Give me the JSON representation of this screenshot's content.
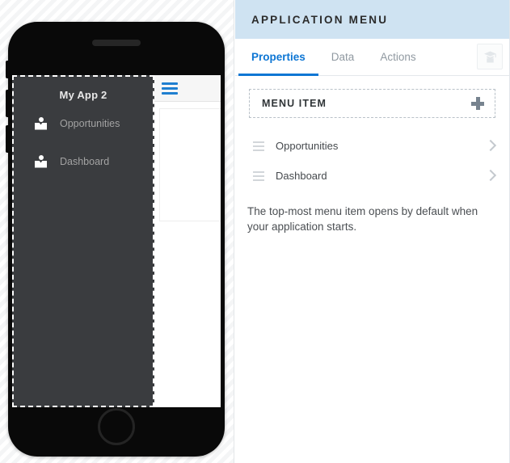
{
  "preview": {
    "device": {
      "name": "iphone-mockup",
      "speaker_icon": "speaker-grill",
      "home_button_icon": "home-button",
      "side_buttons": [
        "silent-switch",
        "volume-up-button",
        "volume-down-button"
      ]
    },
    "app": {
      "title": "My App 2",
      "nav_items": [
        {
          "label": "Opportunities",
          "icon": "person-icon"
        },
        {
          "label": "Dashboard",
          "icon": "person-icon"
        }
      ]
    },
    "topbar": {
      "menu_icon": "hamburger-icon"
    }
  },
  "properties_panel": {
    "header": {
      "title": "APPLICATION MENU"
    },
    "tabs": [
      {
        "label": "Properties",
        "active": true
      },
      {
        "label": "Data",
        "active": false
      },
      {
        "label": "Actions",
        "active": false
      }
    ],
    "help_button": {
      "icon": "graduation-cap-icon"
    },
    "menu_item_section": {
      "title": "MENU ITEM",
      "add_button_icon": "plus-icon",
      "items": [
        {
          "label": "Opportunities",
          "drag_icon": "drag-handle-icon",
          "chevron_icon": "chevron-right-icon"
        },
        {
          "label": "Dashboard",
          "drag_icon": "drag-handle-icon",
          "chevron_icon": "chevron-right-icon"
        }
      ]
    },
    "helper_text": "The top-most menu item opens by default when your application starts."
  },
  "colors": {
    "header_bg": "#cfe3f2",
    "accent_blue": "#0d76d4",
    "nav_panel_bg": "#3a3c3f",
    "phone_body": "#090909",
    "muted_text": "#9099a1"
  }
}
